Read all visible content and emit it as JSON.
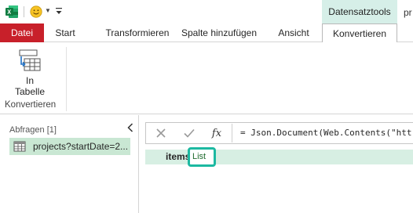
{
  "quick_access": {
    "app_icon": "excel-logo-icon",
    "feedback_icon": "smiley-icon",
    "customize_icon": "customize-toolbar-icon"
  },
  "ribbon_tabs": {
    "contextual_group": "Datensatztools",
    "contextual_right_fragment": "pr",
    "file": "Datei",
    "start": "Start",
    "transform": "Transformieren",
    "add_column": "Spalte hinzufügen",
    "view": "Ansicht",
    "convert": "Konvertieren"
  },
  "ribbon": {
    "into_table_line1": "In",
    "into_table_line2": "Tabelle",
    "group_label": "Konvertieren"
  },
  "queries": {
    "title": "Abfragen [1]",
    "items": [
      {
        "label": "projects?startDate=2..."
      }
    ]
  },
  "formula_bar": {
    "cancel_icon": "close-icon",
    "confirm_icon": "check-icon",
    "fx_label": "fx",
    "formula": "= Json.Document(Web.Contents(\"htt"
  },
  "record": {
    "key": "items",
    "value": "List"
  },
  "colors": {
    "file_tab": "#c8202a",
    "contextual_header": "#d6efe8",
    "selected_query": "#c9e7d3",
    "highlight": "#1cb9a1"
  }
}
